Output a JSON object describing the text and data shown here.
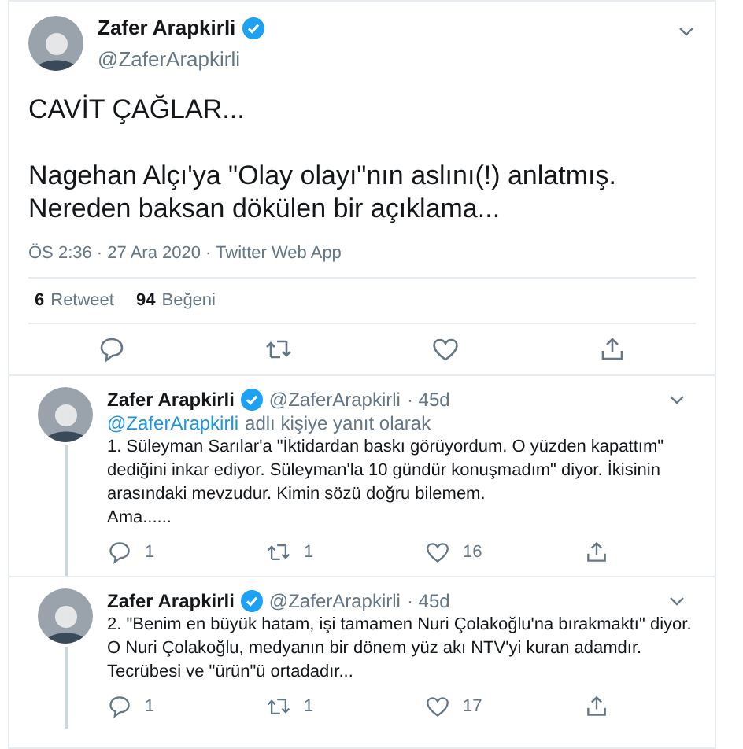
{
  "main_tweet": {
    "name": "Zafer Arapkirli",
    "verified": true,
    "handle": "@ZaferArapkirli",
    "title": "CAVİT ÇAĞLAR...",
    "body": "Nagehan Alçı'ya \"Olay olayı\"nın aslını(!) anlatmış.\nNereden baksan dökülen bir açıklama...",
    "timestamp": "ÖS 2:36 · 27 Ara 2020 · Twitter Web App",
    "stats": [
      {
        "count": "6",
        "label": "Retweet"
      },
      {
        "count": "94",
        "label": "Beğeni"
      }
    ]
  },
  "replies": [
    {
      "name": "Zafer Arapkirli",
      "verified": true,
      "handle": "@ZaferArapkirli",
      "time": "· 45d",
      "reply_to": {
        "handle": "@ZaferArapkirli",
        "text": "adlı kişiye yanıt olarak"
      },
      "text": "1. Süleyman Sarılar'a \"İktidardan baskı görüyordum. O yüzden kapattım\"\ndediğini inkar ediyor. Süleyman'la 10 gündür konuşmadım\" diyor. İkisinin\narasındaki mevzudur. Kimin sözü doğru bilemem.\nAma......",
      "replies": "1",
      "retweets": "1",
      "likes": "16"
    },
    {
      "name": "Zafer Arapkirli",
      "verified": true,
      "handle": "@ZaferArapkirli",
      "time": "· 45d",
      "text": "2. \"Benim en büyük hatam, işi tamamen Nuri Çolakoğlu'na bırakmaktı\" diyor.\nO Nuri Çolakoğlu, medyanın bir dönem yüz akı NTV'yi kuran adamdır.\nTecrübesi ve \"ürün\"ü ortadadır...",
      "replies": "1",
      "retweets": "1",
      "likes": "17"
    }
  ]
}
